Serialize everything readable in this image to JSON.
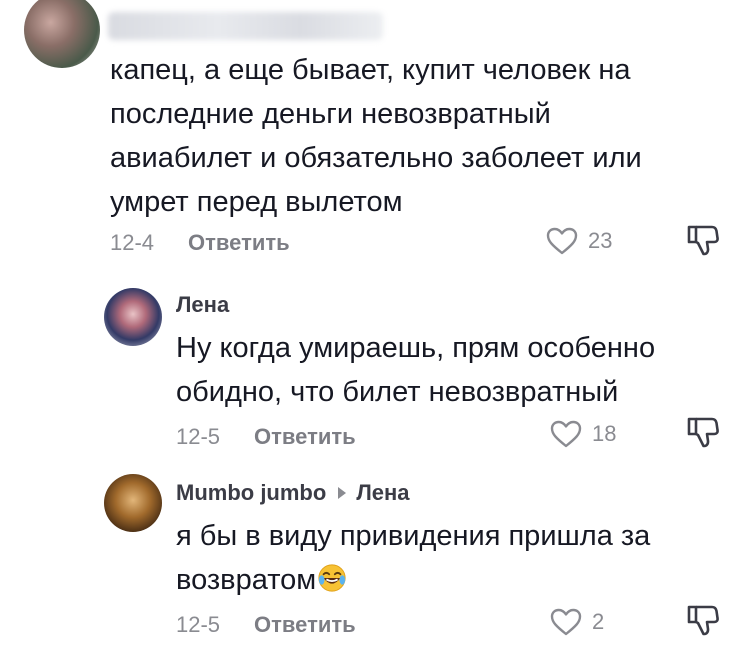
{
  "comments": [
    {
      "text": "капец, а еще бывает, купит человек на\nпоследние деньги невозвратный\nавиабилет и обязательно заболеет или\nумрет перед вылетом",
      "date": "12-4",
      "reply_label": "Ответить",
      "likes": "23"
    },
    {
      "author": "Лена",
      "text": "Ну когда умираешь, прям особенно\nобидно, что билет невозвратный",
      "date": "12-5",
      "reply_label": "Ответить",
      "likes": "18"
    },
    {
      "author": "Mumbo jumbo",
      "reply_to": "Лена",
      "text": "я бы в виду привидения пришла за\nвозвратом",
      "emoji": "rolling-on-floor-laughing-emoji",
      "date": "12-5",
      "reply_label": "Ответить",
      "likes": "2"
    }
  ],
  "icons": {
    "like": "heart-outline-icon",
    "dislike": "thumbs-down-outline-icon"
  },
  "colors": {
    "text": "#161823",
    "muted": "#8a8b91",
    "username": "#3b3c46"
  }
}
